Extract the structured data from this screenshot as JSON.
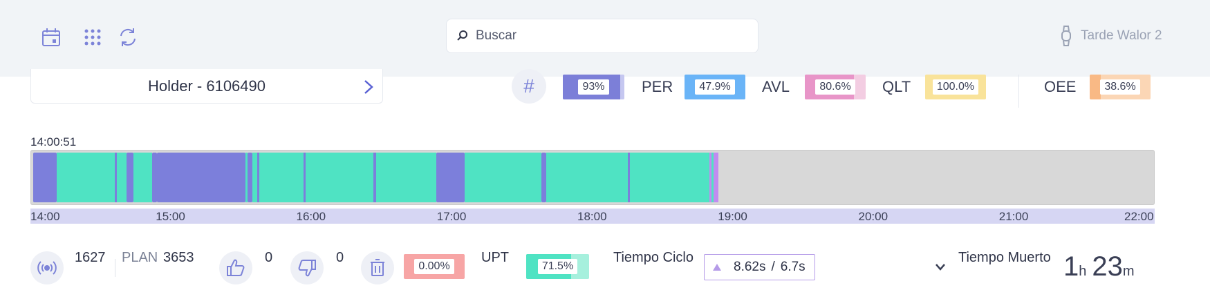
{
  "toolbar": {
    "search_placeholder": "Buscar",
    "user_name": "Tarde Walor 2"
  },
  "holder": {
    "label": "Holder - 6106490"
  },
  "kpis": {
    "hash_symbol": "#",
    "first": {
      "value": "93%",
      "fill": 0.93,
      "color": "#7c7fd8"
    },
    "per": {
      "label": "PER",
      "value": "47.9%",
      "color": "#6ab4f7"
    },
    "avl": {
      "label": "AVL",
      "value": "80.6%",
      "color": "#e895c8"
    },
    "qlt": {
      "label": "QLT",
      "value": "100.0%",
      "color": "#f9e39a"
    },
    "oee": {
      "label": "OEE",
      "value": "38.6%",
      "color": "#f9b985"
    }
  },
  "timeline": {
    "start_label": "14:00:51",
    "ticks": [
      "14:00",
      "15:00",
      "16:00",
      "17:00",
      "18:00",
      "19:00",
      "20:00",
      "21:00",
      "22:00"
    ],
    "colors": {
      "running": "#4fe3c3",
      "stopped": "#7c7fdb",
      "other": "#c08cf0",
      "idle": "#d8d8d8"
    },
    "segments": [
      {
        "start": "14:00",
        "end": "14:10",
        "state": "stopped"
      },
      {
        "start": "14:10",
        "end": "14:35",
        "state": "running"
      },
      {
        "start": "14:35",
        "end": "14:36",
        "state": "stopped"
      },
      {
        "start": "14:36",
        "end": "14:40",
        "state": "running"
      },
      {
        "start": "14:40",
        "end": "14:43",
        "state": "stopped"
      },
      {
        "start": "14:43",
        "end": "14:51",
        "state": "running"
      },
      {
        "start": "14:51",
        "end": "14:53",
        "state": "stopped"
      },
      {
        "start": "14:53",
        "end": "15:31",
        "state": "stopped"
      },
      {
        "start": "15:31",
        "end": "15:32",
        "state": "running"
      },
      {
        "start": "15:32",
        "end": "15:34",
        "state": "stopped"
      },
      {
        "start": "15:34",
        "end": "15:36",
        "state": "running"
      },
      {
        "start": "15:36",
        "end": "15:37",
        "state": "stopped"
      },
      {
        "start": "15:37",
        "end": "15:56",
        "state": "running"
      },
      {
        "start": "15:56",
        "end": "15:57",
        "state": "stopped"
      },
      {
        "start": "15:57",
        "end": "16:26",
        "state": "running"
      },
      {
        "start": "16:26",
        "end": "16:27",
        "state": "stopped"
      },
      {
        "start": "16:27",
        "end": "16:53",
        "state": "running"
      },
      {
        "start": "16:53",
        "end": "17:05",
        "state": "stopped"
      },
      {
        "start": "17:05",
        "end": "17:38",
        "state": "running"
      },
      {
        "start": "17:38",
        "end": "17:40",
        "state": "stopped"
      },
      {
        "start": "17:40",
        "end": "18:15",
        "state": "running"
      },
      {
        "start": "18:15",
        "end": "18:16",
        "state": "stopped"
      },
      {
        "start": "18:16",
        "end": "18:50",
        "state": "running"
      },
      {
        "start": "18:50",
        "end": "18:51",
        "state": "other"
      },
      {
        "start": "18:51",
        "end": "18:52",
        "state": "running"
      },
      {
        "start": "18:52",
        "end": "18:54",
        "state": "other"
      }
    ]
  },
  "stats": {
    "count": "1627",
    "plan_label": "PLAN",
    "plan_value": "3653",
    "likes": "0",
    "dislikes": "0",
    "scrap_pct": {
      "value": "0.00%",
      "color": "#f7a5a5"
    },
    "upt_label": "UPT",
    "upt_pct": {
      "value": "71.5%",
      "fill": 0.715,
      "color": "#4fe3c3"
    },
    "cycle_label": "Tiempo Ciclo",
    "cycle_value": "8.62s",
    "cycle_sep": "/",
    "cycle_target": "6.7s",
    "dead_label": "Tiempo Muerto",
    "dead_hours": "1",
    "dead_hours_unit": "h",
    "dead_minutes": "23",
    "dead_minutes_unit": "m"
  }
}
